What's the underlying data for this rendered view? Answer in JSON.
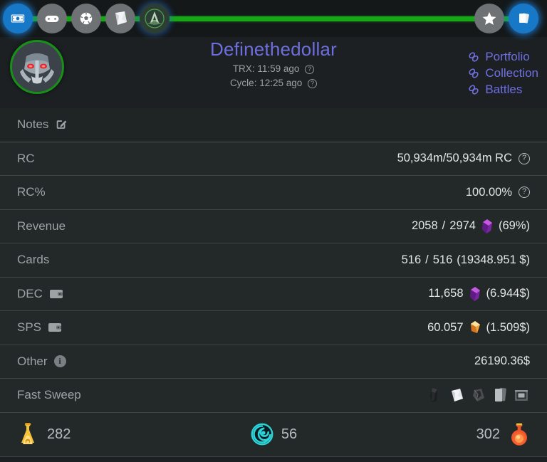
{
  "topnav": {
    "items": [
      {
        "name": "cash-icon",
        "label": "Cash",
        "state": "active"
      },
      {
        "name": "gamepad-icon",
        "label": "Gamepad",
        "state": "normal"
      },
      {
        "name": "ball-icon",
        "label": "Ball",
        "state": "normal"
      },
      {
        "name": "pack-icon",
        "label": "Pack",
        "state": "normal"
      },
      {
        "name": "archon-icon",
        "label": "Archon",
        "state": "logo"
      },
      {
        "name": "star-icon",
        "label": "Favorites",
        "state": "normal"
      },
      {
        "name": "cards-icon",
        "label": "Cards",
        "state": "active"
      }
    ],
    "progress_color": "#17a817"
  },
  "header": {
    "username": "Definethedollar",
    "username_color": "#6e6ede",
    "trx_label": "TRX:",
    "trx_value": "11:59 ago",
    "cycle_label": "Cycle:",
    "cycle_value": "12:25 ago",
    "avatar_name": "robot-avatar",
    "avatar_border_color": "#169016",
    "links": [
      {
        "name": "link-portfolio",
        "label": "Portfolio"
      },
      {
        "name": "link-collection",
        "label": "Collection"
      },
      {
        "name": "link-battles",
        "label": "Battles"
      }
    ]
  },
  "rows": {
    "notes": {
      "label": "Notes"
    },
    "rc": {
      "label": "RC",
      "value": "50,934m/50,934m RC"
    },
    "rcpct": {
      "label": "RC%",
      "value": "100.00%"
    },
    "revenue": {
      "label": "Revenue",
      "current": "2058",
      "separator": "/",
      "total": "2974",
      "pct": "(69%)",
      "gem": "dec-crystal"
    },
    "cards": {
      "label": "Cards",
      "current": "516",
      "separator": "/",
      "total": "516",
      "usd": "(19348.951 $)"
    },
    "dec": {
      "label": "DEC",
      "amount": "11,658",
      "usd": "(6.944$)",
      "gem": "dec-crystal"
    },
    "sps": {
      "label": "SPS",
      "amount": "60.057",
      "usd": "(1.509$)",
      "gem": "sps-crystal"
    },
    "other": {
      "label": "Other",
      "value": "26190.36$"
    },
    "fast_sweep": {
      "label": "Fast Sweep",
      "icons": [
        {
          "name": "sweep-icon-dark-pack",
          "label": "Dark Pack"
        },
        {
          "name": "sweep-icon-white-pack",
          "label": "White Pack"
        },
        {
          "name": "sweep-icon-rough-pack",
          "label": "Rough Pack"
        },
        {
          "name": "sweep-icon-card-pair",
          "label": "Card Pair"
        },
        {
          "name": "sweep-icon-chest",
          "label": "Chest"
        }
      ]
    }
  },
  "bottombar": {
    "left": {
      "icon": "gold-potion-icon",
      "value": "282"
    },
    "mid": {
      "icon": "voucher-icon",
      "value": "56"
    },
    "right": {
      "icon": "red-potion-icon",
      "value": "302"
    }
  },
  "colors": {
    "background": "#1c2022",
    "row_background": "#232829",
    "divider": "#3d4446",
    "label": "#9da2a5",
    "value": "#e3e6e7",
    "accent_green": "#17a817",
    "accent_blue": "#1878c8",
    "link": "#6f6fe0"
  }
}
